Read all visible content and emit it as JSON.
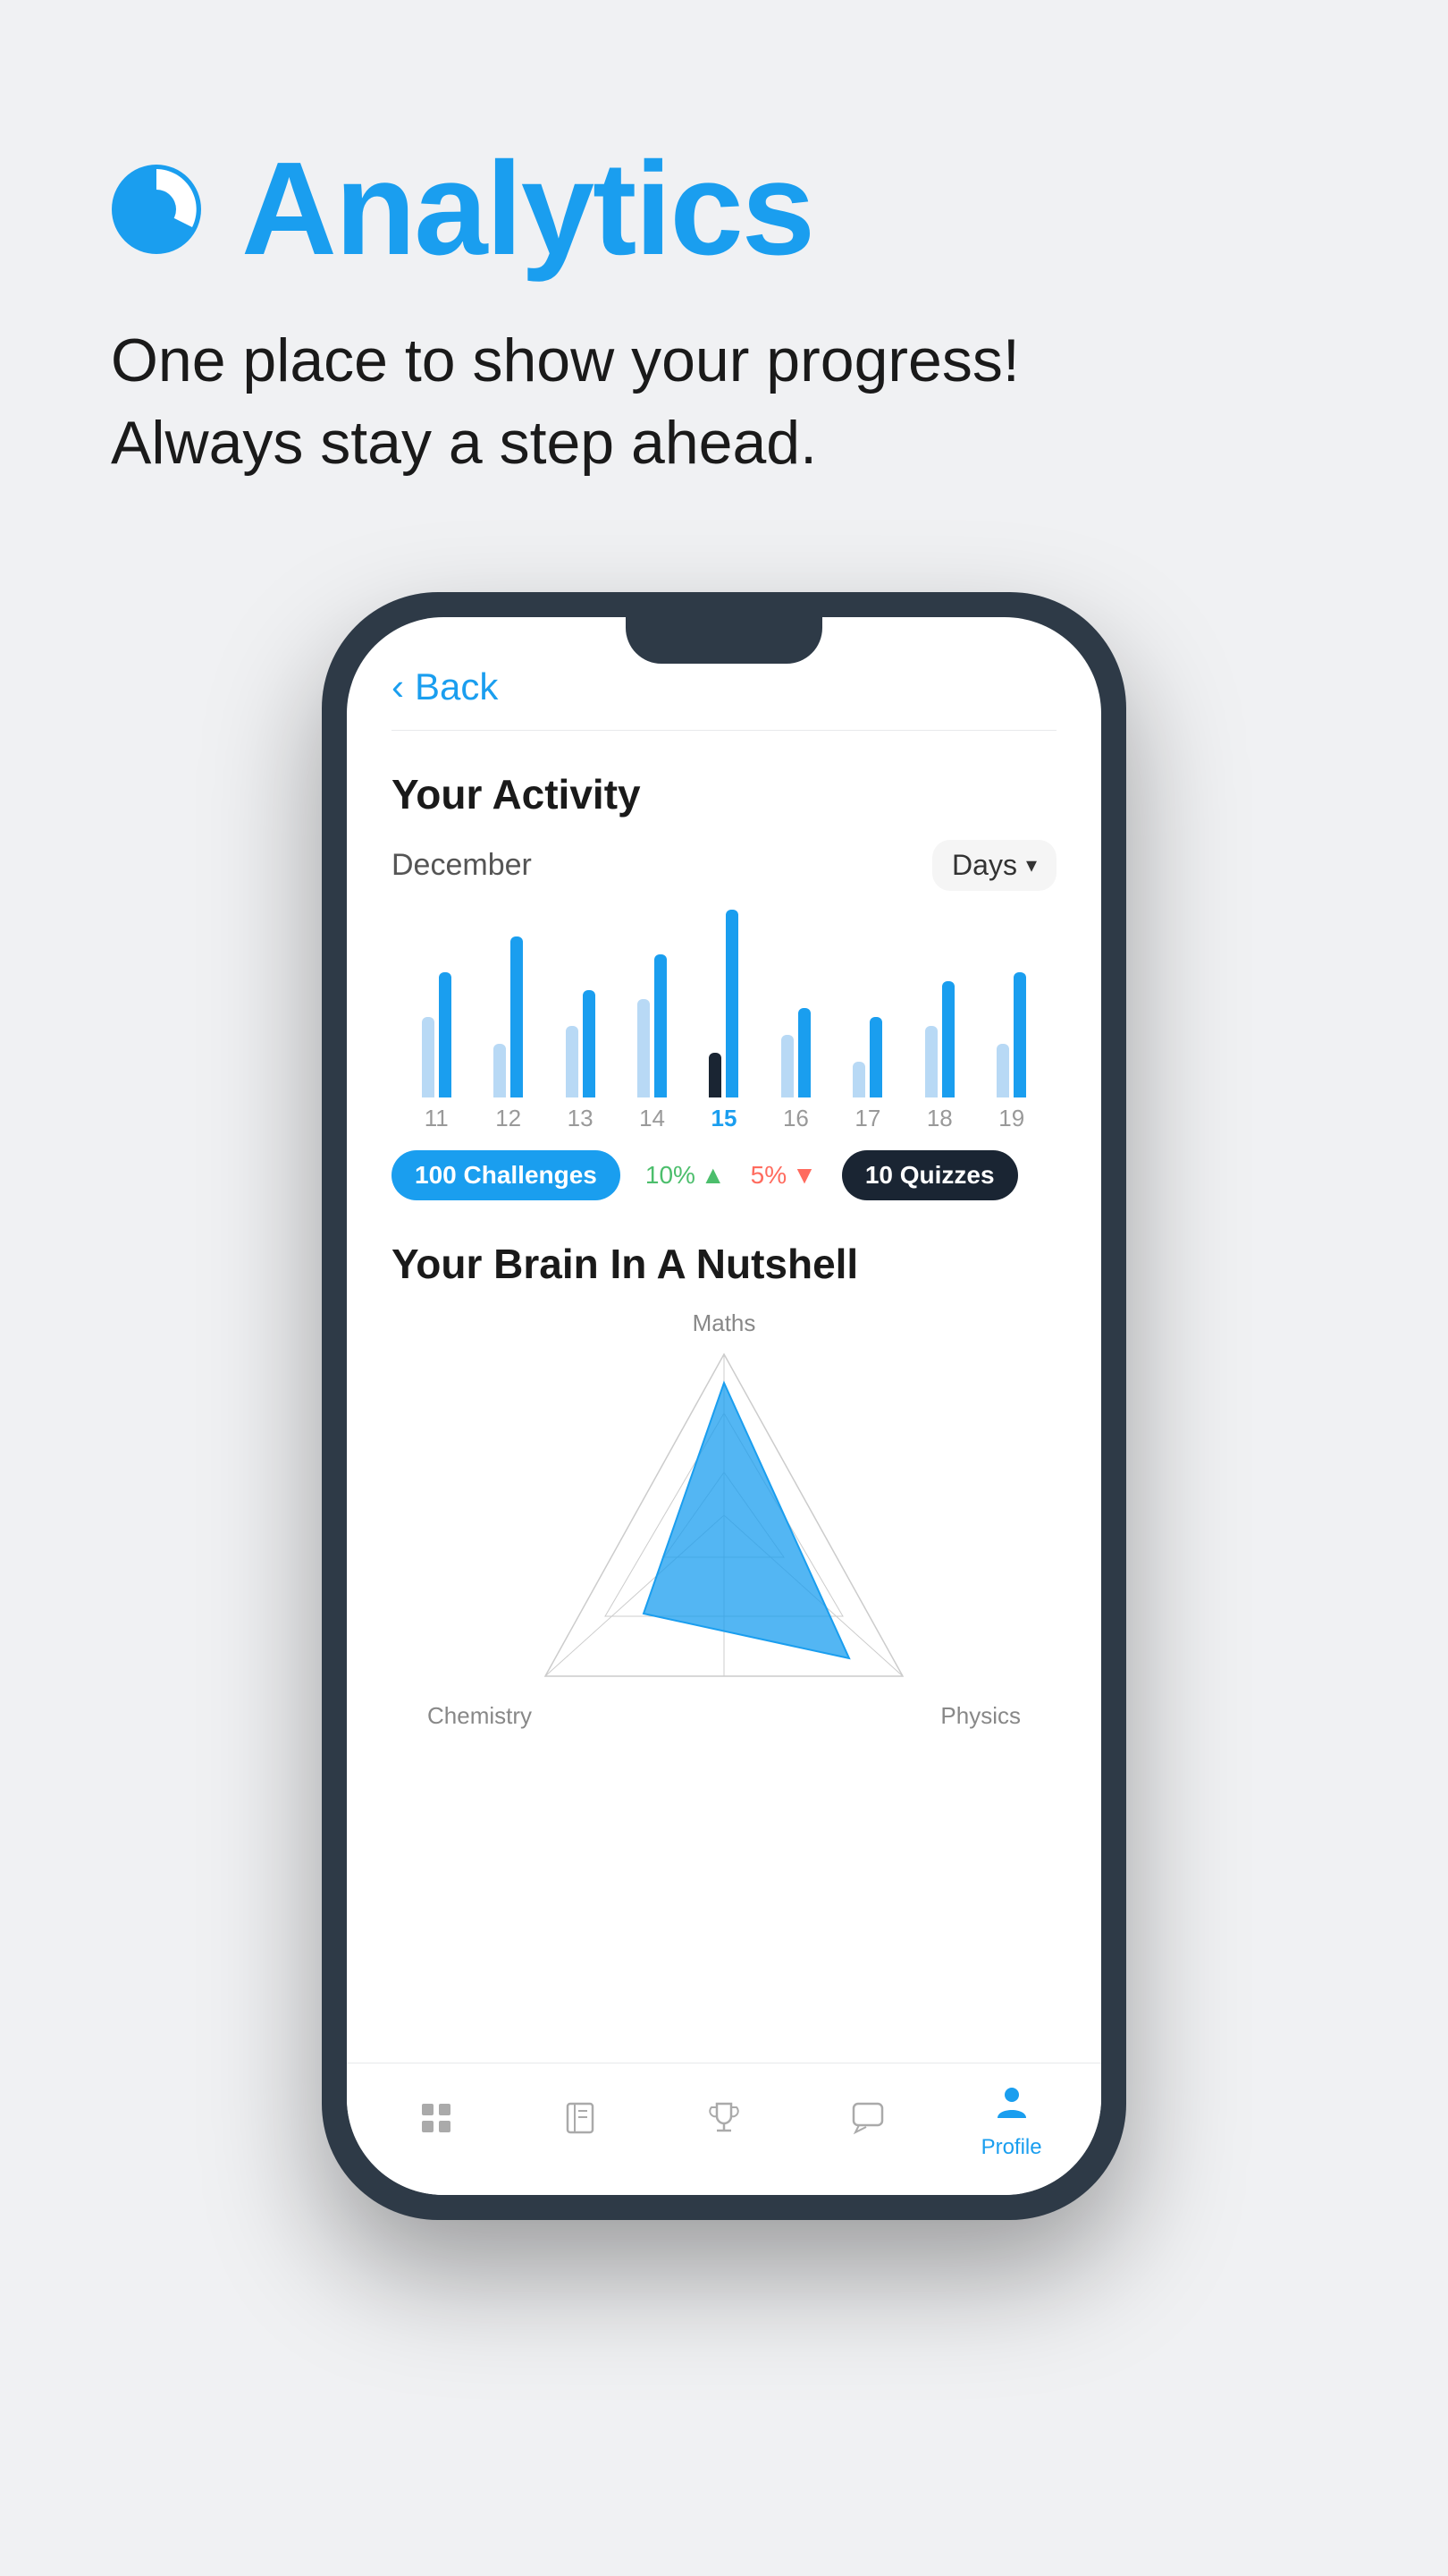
{
  "hero": {
    "title": "Analytics",
    "subtitle_line1": "One place to show your progress!",
    "subtitle_line2": "Always stay a step ahead.",
    "icon_label": "analytics-icon"
  },
  "screen": {
    "back_label": "Back",
    "activity": {
      "title": "Your Activity",
      "month": "December",
      "filter": "Days",
      "bars": [
        {
          "day": "11",
          "heights": [
            90,
            140
          ],
          "active": false
        },
        {
          "day": "12",
          "heights": [
            60,
            180
          ],
          "active": false
        },
        {
          "day": "13",
          "heights": [
            80,
            120
          ],
          "active": false
        },
        {
          "day": "14",
          "heights": [
            110,
            160
          ],
          "active": false
        },
        {
          "day": "15",
          "heights": [
            50,
            210
          ],
          "active": true
        },
        {
          "day": "16",
          "heights": [
            70,
            100
          ],
          "active": false
        },
        {
          "day": "17",
          "heights": [
            40,
            90
          ],
          "active": false
        },
        {
          "day": "18",
          "heights": [
            80,
            130
          ],
          "active": false
        },
        {
          "day": "19",
          "heights": [
            60,
            140
          ],
          "active": false
        }
      ],
      "challenges_badge": "100 Challenges",
      "stat_green": "10%",
      "stat_red": "5%",
      "quizzes_badge": "10 Quizzes"
    },
    "brain": {
      "title": "Your Brain In A Nutshell",
      "labels": {
        "top": "Maths",
        "bottom_left": "Chemistry",
        "bottom_right": "Physics"
      }
    },
    "bottom_nav": {
      "items": [
        {
          "label": "",
          "icon": "home-icon",
          "active": false
        },
        {
          "label": "",
          "icon": "book-icon",
          "active": false
        },
        {
          "label": "",
          "icon": "trophy-icon",
          "active": false
        },
        {
          "label": "",
          "icon": "chat-icon",
          "active": false
        },
        {
          "label": "Profile",
          "icon": "profile-icon",
          "active": true
        }
      ]
    }
  },
  "colors": {
    "brand_blue": "#1a9eef",
    "dark": "#1a2533",
    "text_primary": "#1a1a1a",
    "text_secondary": "#555555",
    "green": "#4cbe6c",
    "red": "#ff6b5e",
    "bg": "#f0f1f3"
  }
}
